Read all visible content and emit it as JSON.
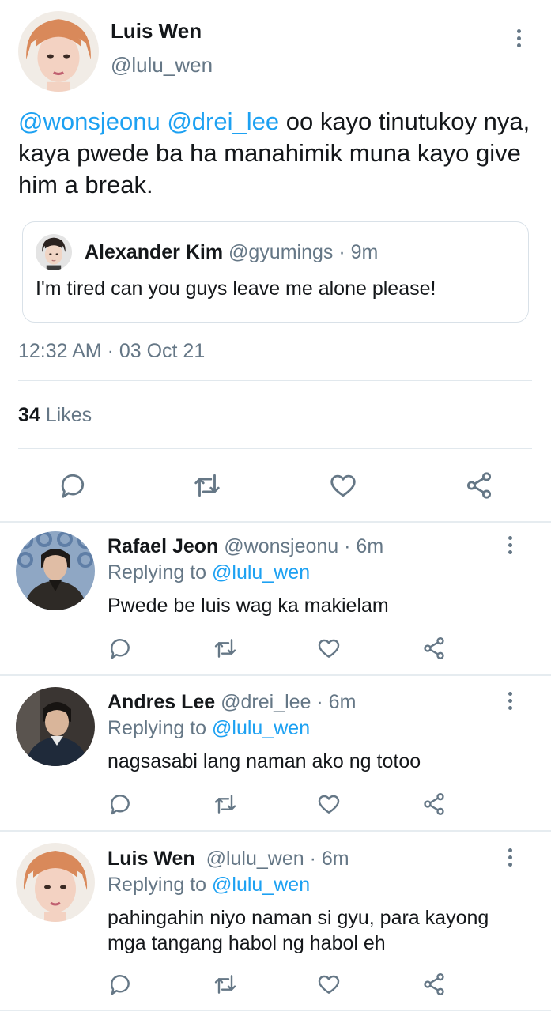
{
  "main_tweet": {
    "name": "Luis Wen",
    "handle": "@lulu_wen",
    "text_mentions": [
      "@wonsjeonu",
      "@drei_lee"
    ],
    "text_body": " oo kayo tinutukoy nya, kaya pwede ba ha manahimik muna kayo give him a break.",
    "quote": {
      "name": "Alexander Kim",
      "handle": "@gyumings",
      "time": " · 9m",
      "text": "I'm tired can you guys leave me alone please!"
    },
    "timestamp": "12:32 AM · 03 Oct 21",
    "likes_count": "34",
    "likes_label": " Likes"
  },
  "replies": [
    {
      "name": "Rafael Jeon",
      "handle": " @wonsjeonu",
      "time": " · 6m",
      "replying_label": "Replying to ",
      "replying_to": "@lulu_wen",
      "text": "Pwede be luis wag ka makielam"
    },
    {
      "name": "Andres Lee",
      "handle": " @drei_lee",
      "time": " · 6m",
      "replying_label": "Replying to ",
      "replying_to": "@lulu_wen",
      "text": "nagsasabi lang naman ako ng totoo"
    },
    {
      "name": "Luis Wen",
      "handle": "  @lulu_wen",
      "time": " · 6m",
      "replying_label": "Replying to ",
      "replying_to": "@lulu_wen",
      "text": "pahingahin niyo naman si gyu, para kayong mga tangang habol ng habol eh"
    }
  ],
  "icons": [
    "reply-icon",
    "retweet-icon",
    "like-icon",
    "share-icon",
    "more-options-icon"
  ],
  "colors": {
    "link": "#1da1f2",
    "secondary_text": "#657786",
    "icon": "#657786",
    "divider": "#e1e8ed"
  }
}
